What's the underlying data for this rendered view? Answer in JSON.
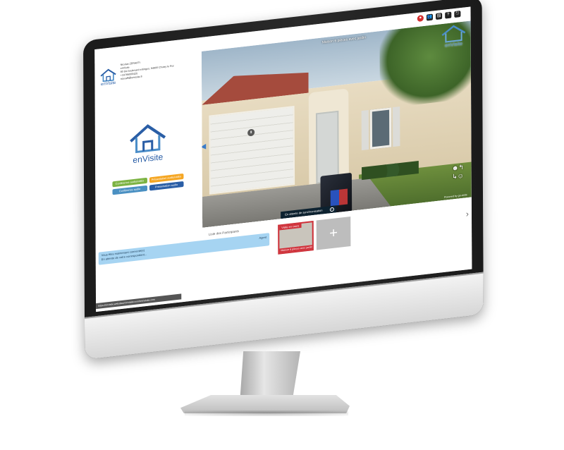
{
  "app": {
    "brand": "enVisite"
  },
  "contact": {
    "lines": [
      "Nicolas ZERAFFI",
      "enVisite",
      "80 bis boulevard estingos, 94800 Choisy le Roi",
      "+33786000425",
      "nzeraffi@envisite.fr"
    ]
  },
  "actions": {
    "conf_auto": "Conférence audio/vidéo",
    "pres_auto": "Présentation audio/vidéo",
    "conf_audio": "Conférence audio",
    "pres_audio": "Présentation audio"
  },
  "scene": {
    "title": "Maison 6 pièces avec jardin",
    "sync_text": "En attente de synchronisation",
    "powered_by": "Powered by go-visite"
  },
  "participants": {
    "title": "Liste des Participants",
    "message_line1": "Vous êtes maintenant connecté(e)",
    "message_line2": "En attente de votre correspondant...",
    "role": "Agent"
  },
  "visits": {
    "current_tag": "Visite en cours",
    "current_caption": "Maison 6 pièces avec jardin"
  },
  "status": {
    "url": "https://envisite.websiteurl.fr/vitelecoonfreenvisite.cem"
  },
  "colors": {
    "brand_blue": "#2a5ea6",
    "accent_red": "#d0313a",
    "chat_blue": "#a6d4f2"
  }
}
